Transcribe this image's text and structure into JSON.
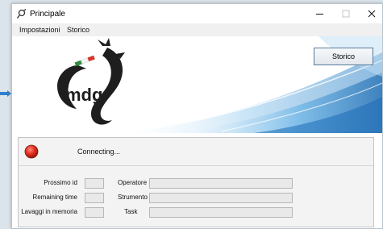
{
  "window": {
    "title": "Principale"
  },
  "menu": {
    "impostazioni": "Impostazioni",
    "storico": "Storico"
  },
  "banner": {
    "logo_text": "mdg",
    "storico_button": "Storico"
  },
  "status": {
    "text": "Connecting..."
  },
  "fields": {
    "prossimo_id": {
      "label": "Prossimo id",
      "value": ""
    },
    "remaining_time": {
      "label": "Remaining time",
      "value": ""
    },
    "lavaggi": {
      "label": "Lavaggi in memoria",
      "value": ""
    },
    "operatore": {
      "label": "Operatore",
      "value": ""
    },
    "strumento": {
      "label": "Strumento",
      "value": ""
    },
    "task": {
      "label": "Task",
      "value": ""
    }
  },
  "colors": {
    "accent_blue": "#2a7fc5",
    "status_red": "#d4281e"
  },
  "icons": {
    "app": "pin-icon",
    "minimize": "minimize-icon",
    "maximize": "maximize-icon",
    "close": "close-icon",
    "logo": "dragon-logo",
    "status": "red-status-led"
  }
}
